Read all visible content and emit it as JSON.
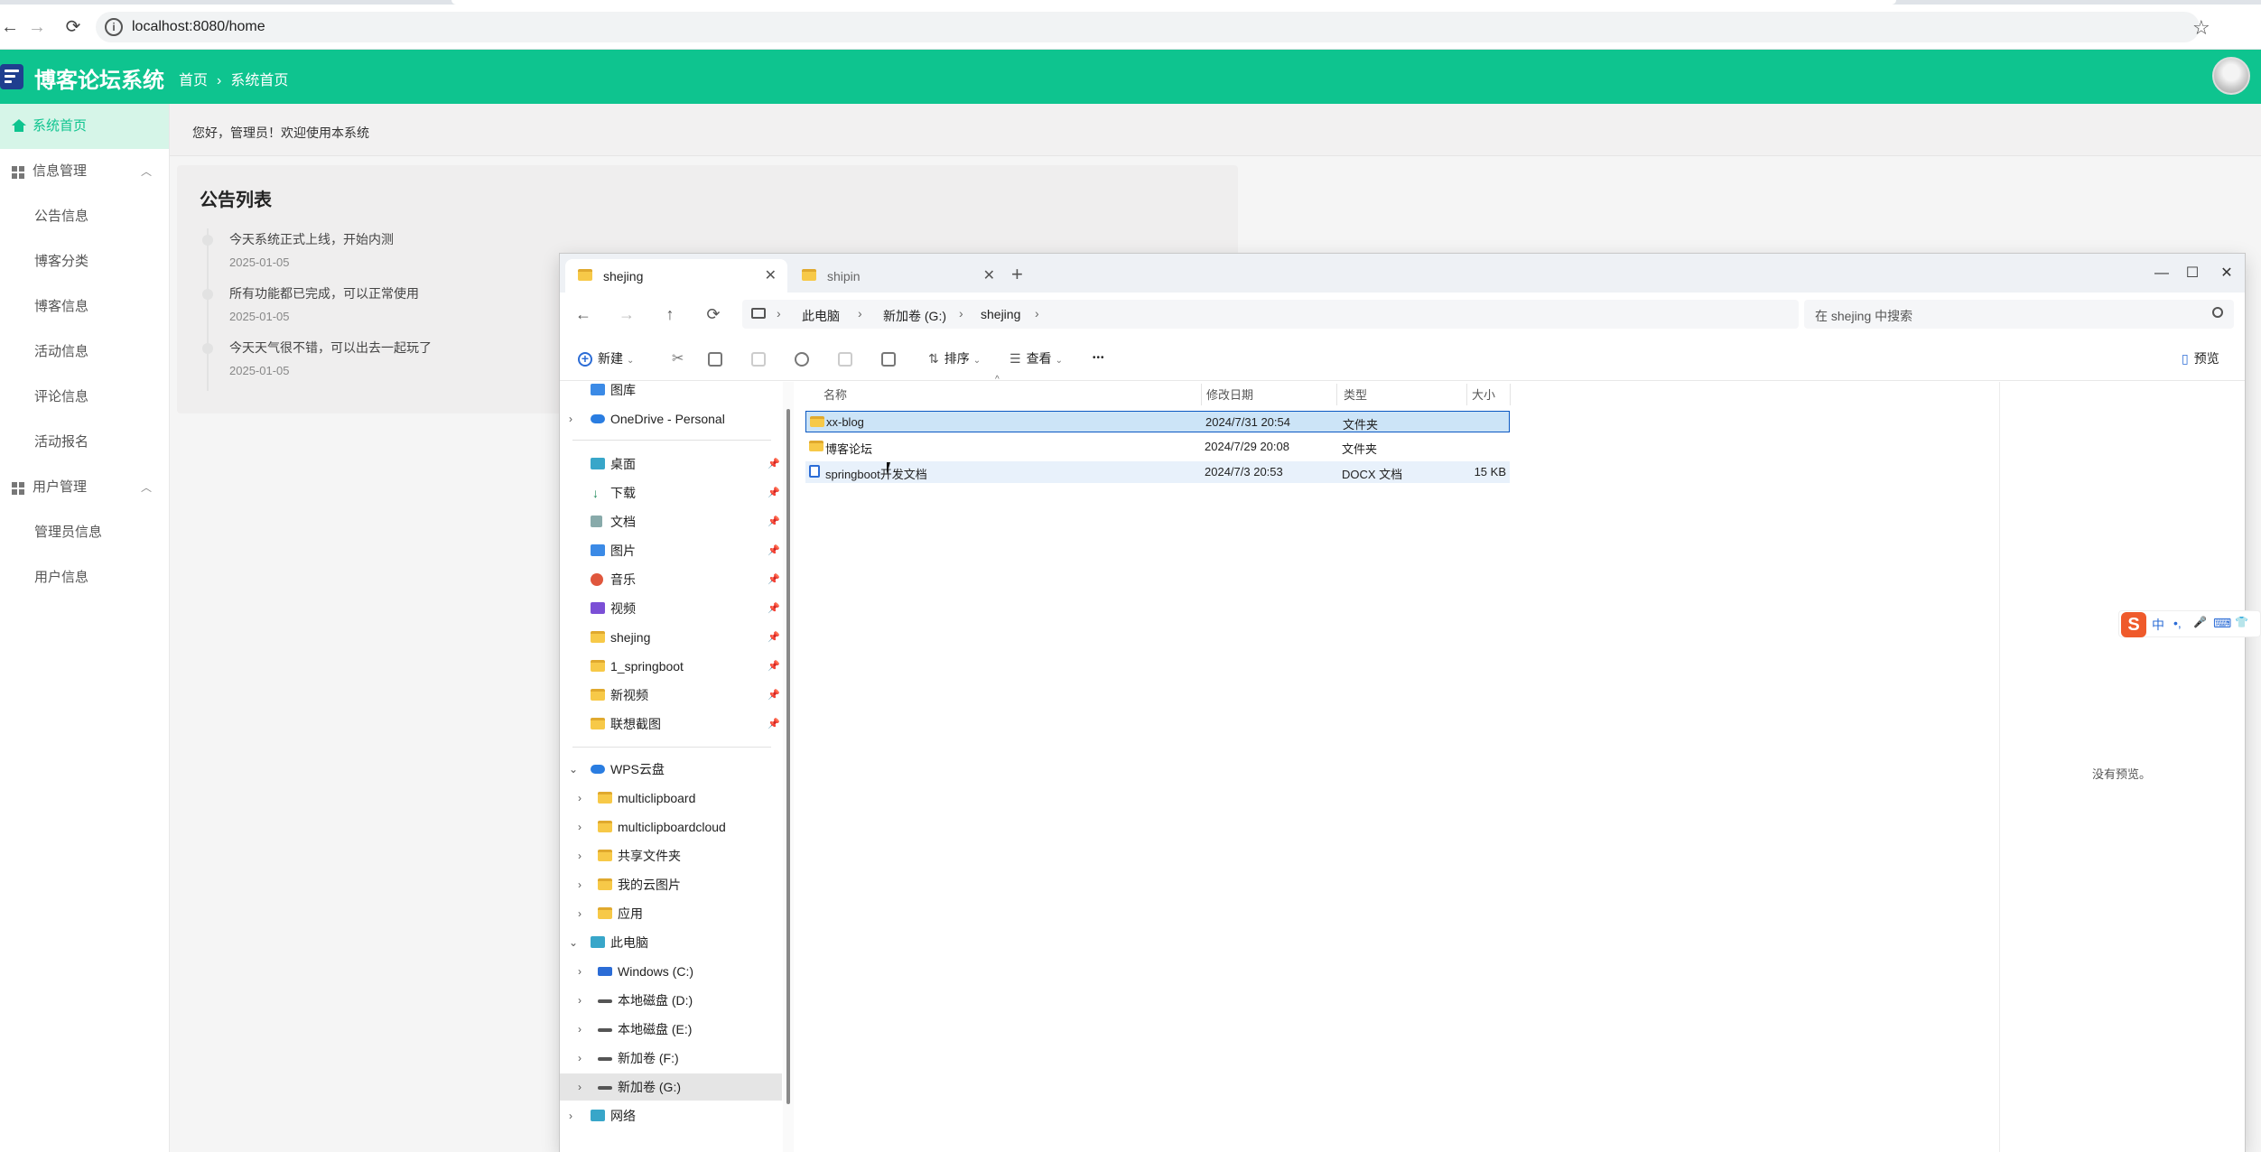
{
  "browser": {
    "url": "localhost:8080/home",
    "back": "←",
    "forward": "→",
    "reload": "⟳",
    "info": "i",
    "star": "☆"
  },
  "app": {
    "title": "博客论坛系统",
    "breadcrumb": [
      "首页",
      "系统首页"
    ],
    "breadcrumb_sep": "›",
    "accent": "#0ec48f",
    "greeting": "您好，管理员！欢迎使用本系统",
    "menu": {
      "home": "系统首页",
      "info_group": "信息管理",
      "info_items": [
        "公告信息",
        "博客分类",
        "博客信息",
        "活动信息",
        "评论信息",
        "活动报名"
      ],
      "user_group": "用户管理",
      "user_items": [
        "管理员信息",
        "用户信息"
      ],
      "caret": "︿"
    },
    "notices": {
      "title": "公告列表",
      "items": [
        {
          "text": "今天系统正式上线，开始内测",
          "date": "2025-01-05"
        },
        {
          "text": "所有功能都已完成，可以正常使用",
          "date": "2025-01-05"
        },
        {
          "text": "今天天气很不错，可以出去一起玩了",
          "date": "2025-01-05"
        }
      ]
    }
  },
  "explorer": {
    "tabs": [
      {
        "label": "shejing",
        "active": true
      },
      {
        "label": "shipin",
        "active": false
      }
    ],
    "close": "✕",
    "new_tab": "+",
    "win": {
      "min": "—",
      "max": "☐",
      "close": "✕"
    },
    "nav": {
      "back": "←",
      "forward": "→",
      "up": "↑",
      "refresh": "⟳"
    },
    "address": [
      "此电脑",
      "新加卷 (G:)",
      "shejing"
    ],
    "address_sep": "›",
    "search_placeholder": "在 shejing 中搜索",
    "toolbar": {
      "new": "新建",
      "sort": "排序",
      "view": "查看",
      "more": "•••",
      "preview": "预览",
      "dropdown": "⌄"
    },
    "nav_pane": {
      "gallery": "图库",
      "onedrive": "OneDrive - Personal",
      "quick": [
        "桌面",
        "下载",
        "文档",
        "图片",
        "音乐",
        "视频",
        "shejing",
        "1_springboot",
        "新视频",
        "联想截图"
      ],
      "wps": "WPS云盘",
      "wps_items": [
        "multiclipboard",
        "multiclipboardcloud",
        "共享文件夹",
        "我的云图片",
        "应用"
      ],
      "pc": "此电脑",
      "drives": [
        "Windows (C:)",
        "本地磁盘 (D:)",
        "本地磁盘 (E:)",
        "新加卷 (F:)",
        "新加卷 (G:)"
      ],
      "network": "网络",
      "expand": "›",
      "collapse": "⌄",
      "pin": "📌"
    },
    "columns": [
      "名称",
      "修改日期",
      "类型",
      "大小"
    ],
    "sort_indicator": "^",
    "files": [
      {
        "name": "xx-blog",
        "date": "2024/7/31 20:54",
        "type": "文件夹",
        "size": "",
        "kind": "folder"
      },
      {
        "name": "博客论坛",
        "date": "2024/7/29 20:08",
        "type": "文件夹",
        "size": "",
        "kind": "folder"
      },
      {
        "name": "springboot开发文档",
        "date": "2024/7/3 20:53",
        "type": "DOCX 文档",
        "size": "15 KB",
        "kind": "doc"
      }
    ],
    "no_preview": "没有预览。"
  },
  "ime": {
    "logo": "S",
    "items": [
      "中",
      "•,",
      "🎤",
      "⌨",
      "👕"
    ]
  }
}
